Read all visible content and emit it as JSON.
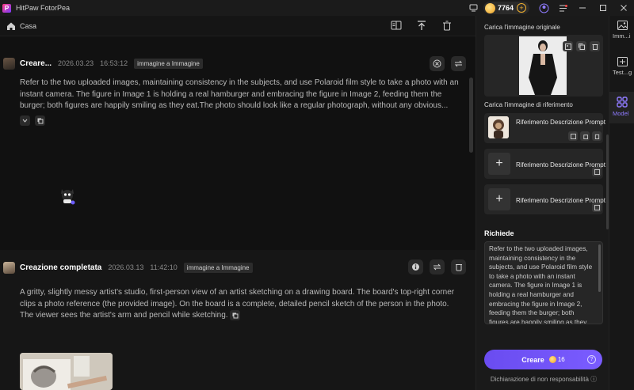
{
  "app": {
    "title": "HitPaw FotorPea",
    "credits": "7764"
  },
  "toolbar": {
    "home_label": "Casa"
  },
  "cards": [
    {
      "title": "Creare...",
      "date": "2026.03.23",
      "time": "16:53:12",
      "tag": "immagine a Immagine",
      "prompt": "Refer to the two uploaded images, maintaining consistency in the subjects, and use Polaroid film style to take a photo with an instant camera. The figure in Image 1 is holding a real hamburger and embracing the figure in Image 2, feeding them the burger; both figures are happily smiling as they eat.The photo should look like a regular photograph, without any obvious..."
    },
    {
      "title": "Creazione completata",
      "date": "2026.03.13",
      "time": "11:42:10",
      "tag": "immagine a Immagine",
      "prompt": "A gritty, slightly messy artist's studio, first-person view of an artist sketching on a drawing board. The board's top-right corner clips a photo reference (the provided image). On the board is a complete, detailed pencil sketch of the person in the photo. The viewer sees the artist's arm and pencil while sketching."
    }
  ],
  "panel": {
    "original_label": "Carica l'immagine originale",
    "reference_label": "Carica l'immagine di riferimento",
    "refs": [
      {
        "label": "Riferimento Descrizione Prompt"
      },
      {
        "label": "Riferimento Descrizione Prompt"
      },
      {
        "label": "Riferimento Descrizione Prompt"
      }
    ],
    "requests_title": "Richiede",
    "requests_text": "Refer to the two uploaded images, maintaining consistency in the subjects, and use Polaroid film style to take a photo with an instant camera. The figure in Image 1 is holding a real hamburger and embracing the figure in Image 2, feeding them the burger; both figures are happily smiling as they",
    "create_label": "Creare",
    "create_cost": "16",
    "disclaimer": "Dichiarazione di non responsabilità"
  },
  "strip": [
    {
      "label": "Imm...i",
      "icon": "image-icon"
    },
    {
      "label": "Test...g",
      "icon": "text-image-icon"
    },
    {
      "label": "Model",
      "icon": "model-icon"
    }
  ],
  "colors": {
    "accent": "#7a5cff",
    "background": "#111111",
    "panel": "#1a1a1a",
    "coin": "#f0a020"
  }
}
